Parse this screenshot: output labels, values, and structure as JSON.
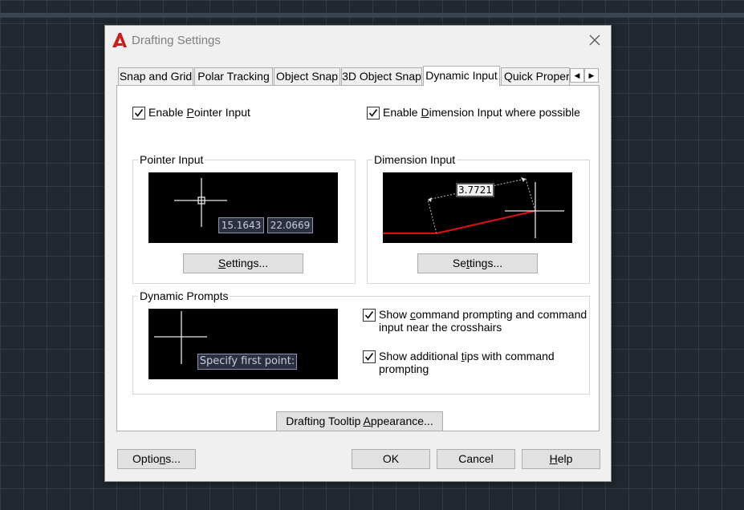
{
  "dialog": {
    "title": "Drafting Settings"
  },
  "tabs": [
    {
      "label": "Snap and Grid",
      "active": false
    },
    {
      "label": "Polar Tracking",
      "active": false
    },
    {
      "label": "Object Snap",
      "active": false
    },
    {
      "label": "3D Object Snap",
      "active": false
    },
    {
      "label": "Dynamic Input",
      "active": true
    },
    {
      "label": "Quick Properties",
      "active": false
    }
  ],
  "pointer": {
    "enable_pre": "Enable ",
    "enable_key": "P",
    "enable_post": "ointer Input",
    "enabled": true,
    "group_title": "Pointer Input",
    "coord_x": "15.1643",
    "coord_y": "22.0669",
    "settings_pre": "",
    "settings_key": "S",
    "settings_post": "ettings..."
  },
  "dimension": {
    "enable_pre": "Enable ",
    "enable_key": "D",
    "enable_post": "imension Input where possible",
    "enabled": true,
    "group_title": "Dimension Input",
    "value": "3.7721",
    "settings_pre": "Se",
    "settings_key": "t",
    "settings_post": "tings..."
  },
  "prompts": {
    "group_title": "Dynamic Prompts",
    "preview_text": "Specify first point:",
    "show_cmd_pre": "Show ",
    "show_cmd_key": "c",
    "show_cmd_line1": "ommand prompting and command",
    "show_cmd_line2": "input near the crosshairs",
    "show_cmd_checked": true,
    "show_tips_pre": "Show additional ",
    "show_tips_key": "t",
    "show_tips_line1": "ips with command",
    "show_tips_line2": "prompting",
    "show_tips_checked": true
  },
  "tooltip_btn": {
    "pre": "Drafting Tooltip ",
    "key": "A",
    "post": "ppearance..."
  },
  "footer": {
    "options_pre": "Optio",
    "options_key": "n",
    "options_post": "s...",
    "ok": "OK",
    "cancel": "Cancel",
    "help_key": "H",
    "help_post": "elp"
  },
  "colors": {
    "logo_red": "#cc1d1d",
    "dim_line": "#e01010"
  }
}
